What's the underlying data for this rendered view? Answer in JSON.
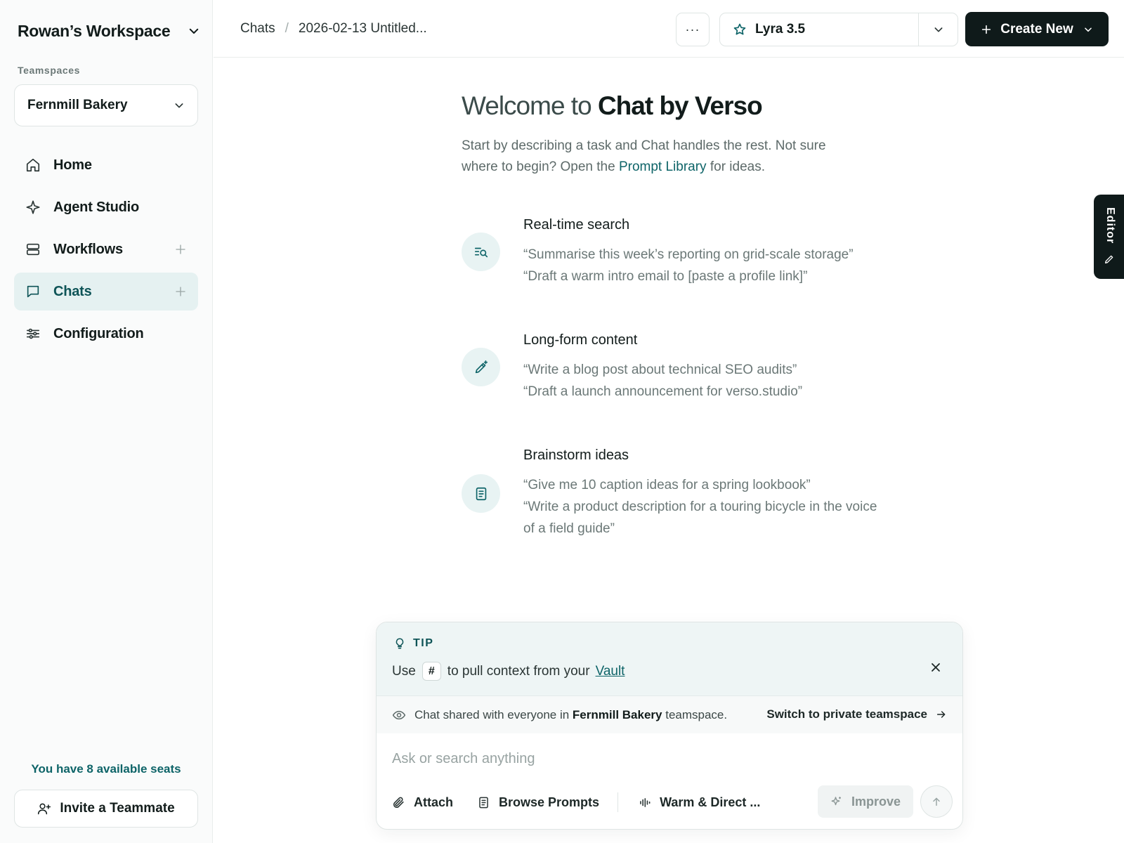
{
  "sidebar": {
    "workspace_title": "Rowan’s Workspace",
    "section_label": "Teamspaces",
    "teamspace": "Fernmill Bakery",
    "items": [
      {
        "label": "Home",
        "icon": "home-icon"
      },
      {
        "label": "Agent Studio",
        "icon": "sparkle-icon"
      },
      {
        "label": "Workflows",
        "icon": "stack-icon"
      },
      {
        "label": "Chats",
        "icon": "chat-bubble-icon"
      },
      {
        "label": "Configuration",
        "icon": "sliders-icon"
      }
    ],
    "seats_text": "You have 8 available seats",
    "invite_label": "Invite a Teammate"
  },
  "topbar": {
    "breadcrumb": [
      "Chats",
      "2026-02-13 Untitled..."
    ],
    "breadcrumb_sep": "/",
    "more_label": "···",
    "model": "Lyra 3.5",
    "create_label": "Create New"
  },
  "welcome": {
    "title_light": "Welcome to",
    "title_bold": "Chat by Verso",
    "desc_before": "Start by describing a task and Chat handles the rest. Not sure where to begin? Open the",
    "desc_link": "Prompt Library",
    "desc_after": "for ideas."
  },
  "features": [
    {
      "title": "Real-time search",
      "icon": "search-list-icon",
      "examples": [
        "“Summarise this week’s reporting on grid-scale storage”",
        "“Draft a warm intro email to [paste a profile link]”"
      ]
    },
    {
      "title": "Long-form content",
      "icon": "pen-sparkle-icon",
      "examples": [
        "“Write a blog post about technical SEO audits”",
        "“Draft a launch announcement for verso.studio”"
      ]
    },
    {
      "title": "Brainstorm ideas",
      "icon": "notepad-icon",
      "examples": [
        "“Give me 10 caption ideas for a spring lookbook”",
        "“Write a product description for a touring bicycle in the voice of a field guide”"
      ]
    }
  ],
  "editor_tab": "Editor",
  "composer": {
    "tip_label": "TIP",
    "tip_before": "Use",
    "tip_key": "#",
    "tip_after": "to pull context from your",
    "tip_link": "Vault",
    "shared_before": "Chat shared with everyone in",
    "shared_team": "Fernmill Bakery",
    "shared_after": "teamspace.",
    "switch_label": "Switch to private teamspace",
    "placeholder": "Ask or search anything",
    "value": "",
    "attach_label": "Attach",
    "browse_label": "Browse Prompts",
    "tone_label": "Warm & Direct ...",
    "improve_label": "Improve"
  },
  "colors": {
    "accent": "#0e6468",
    "active_bg": "#e5f1f1",
    "dark_button": "#0f1a1a"
  }
}
